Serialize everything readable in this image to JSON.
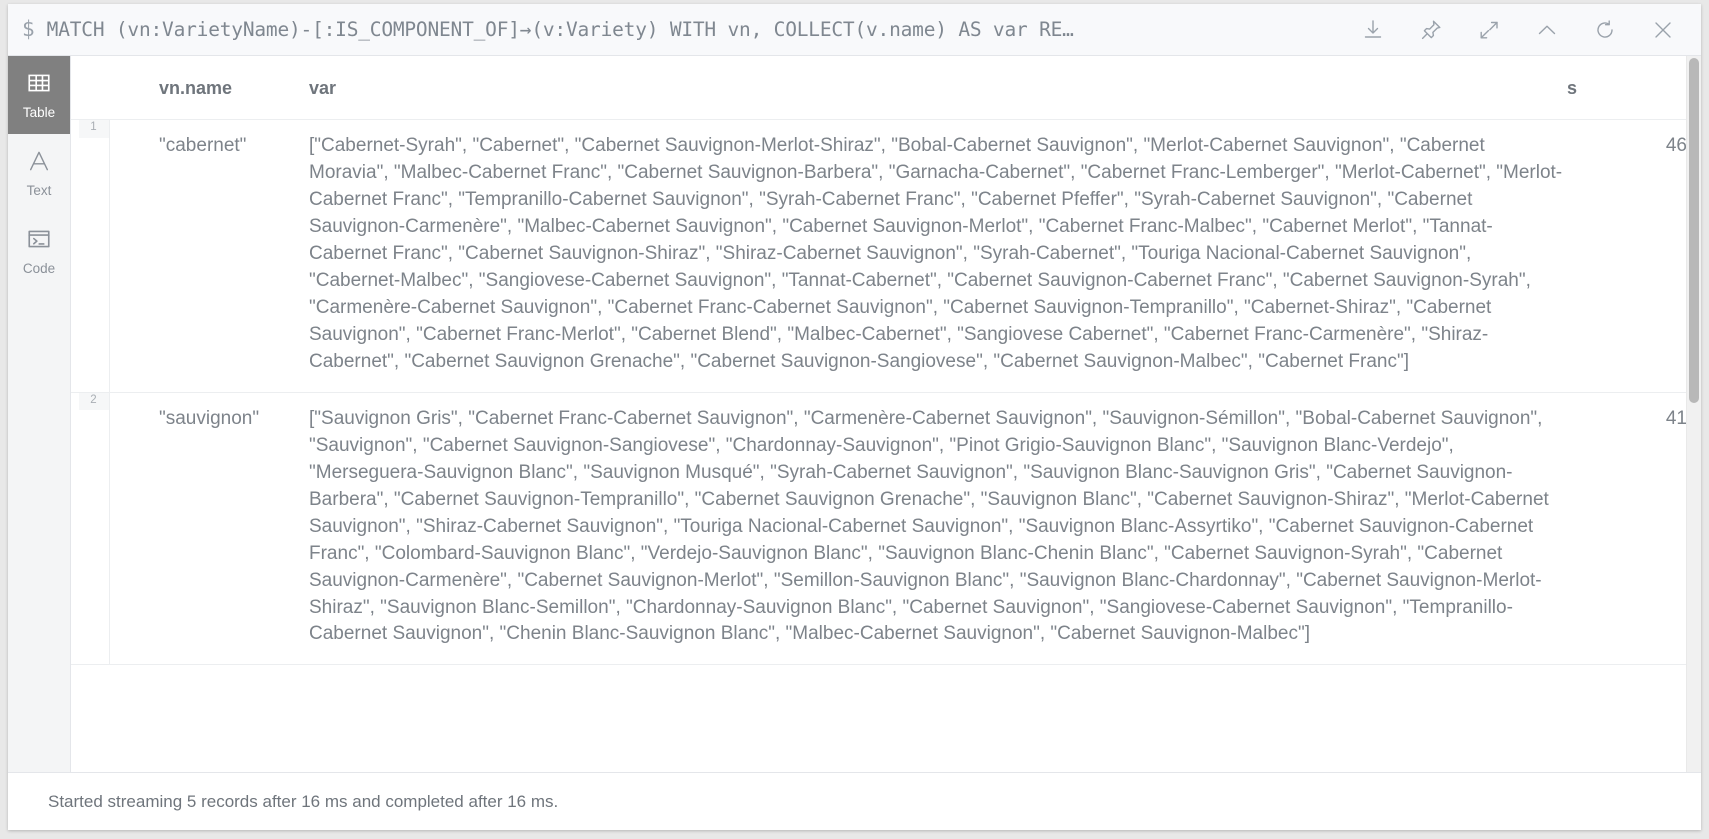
{
  "window": {
    "prompt_sigil": "$",
    "query": "MATCH (vn:VarietyName)-[:IS_COMPONENT_OF]→(v:Variety) WITH vn, COLLECT(v.name) AS var RE…",
    "actions": [
      {
        "name": "download-icon",
        "label": "Download"
      },
      {
        "name": "pin-icon",
        "label": "Pin"
      },
      {
        "name": "expand-icon",
        "label": "Fullscreen"
      },
      {
        "name": "chevron-up-icon",
        "label": "Collapse"
      },
      {
        "name": "refresh-icon",
        "label": "Rerun"
      },
      {
        "name": "close-icon",
        "label": "Close"
      }
    ]
  },
  "sidebar": {
    "items": [
      {
        "label": "Table",
        "icon": "table-icon",
        "active": true
      },
      {
        "label": "Text",
        "icon": "text-icon",
        "active": false
      },
      {
        "label": "Code",
        "icon": "code-icon",
        "active": false
      }
    ]
  },
  "table": {
    "columns": [
      "vn.name",
      "var",
      "s"
    ],
    "rows": [
      {
        "index": "1",
        "name": "\"cabernet\"",
        "var": "[\"Cabernet-Syrah\", \"Cabernet\", \"Cabernet Sauvignon-Merlot-Shiraz\", \"Bobal-Cabernet Sauvignon\", \"Merlot-Cabernet Sauvignon\", \"Cabernet Moravia\", \"Malbec-Cabernet Franc\", \"Cabernet Sauvignon-Barbera\", \"Garnacha-Cabernet\", \"Cabernet Franc-Lemberger\", \"Merlot-Cabernet\", \"Merlot-Cabernet Franc\", \"Tempranillo-Cabernet Sauvignon\", \"Syrah-Cabernet Franc\", \"Cabernet Pfeffer\", \"Syrah-Cabernet Sauvignon\", \"Cabernet Sauvignon-Carmenère\", \"Malbec-Cabernet Sauvignon\", \"Cabernet Sauvignon-Merlot\", \"Cabernet Franc-Malbec\", \"Cabernet Merlot\", \"Tannat-Cabernet Franc\", \"Cabernet Sauvignon-Shiraz\", \"Shiraz-Cabernet Sauvignon\", \"Syrah-Cabernet\", \"Touriga Nacional-Cabernet Sauvignon\", \"Cabernet-Malbec\", \"Sangiovese-Cabernet Sauvignon\", \"Tannat-Cabernet\", \"Cabernet Sauvignon-Cabernet Franc\", \"Cabernet Sauvignon-Syrah\", \"Carmenère-Cabernet Sauvignon\", \"Cabernet Franc-Cabernet Sauvignon\", \"Cabernet Sauvignon-Tempranillo\", \"Cabernet-Shiraz\", \"Cabernet Sauvignon\", \"Cabernet Franc-Merlot\", \"Cabernet Blend\", \"Malbec-Cabernet\", \"Sangiovese Cabernet\", \"Cabernet Franc-Carmenère\", \"Shiraz-Cabernet\", \"Cabernet Sauvignon Grenache\", \"Cabernet Sauvignon-Sangiovese\", \"Cabernet Sauvignon-Malbec\", \"Cabernet Franc\"]",
        "s": "46"
      },
      {
        "index": "2",
        "name": "\"sauvignon\"",
        "var": "[\"Sauvignon Gris\", \"Cabernet Franc-Cabernet Sauvignon\", \"Carmenère-Cabernet Sauvignon\", \"Sauvignon-Sémillon\", \"Bobal-Cabernet Sauvignon\", \"Sauvignon\", \"Cabernet Sauvignon-Sangiovese\", \"Chardonnay-Sauvignon\", \"Pinot Grigio-Sauvignon Blanc\", \"Sauvignon Blanc-Verdejo\", \"Merseguera-Sauvignon Blanc\", \"Sauvignon Musqué\", \"Syrah-Cabernet Sauvignon\", \"Sauvignon Blanc-Sauvignon Gris\", \"Cabernet Sauvignon-Barbera\", \"Cabernet Sauvignon-Tempranillo\", \"Cabernet Sauvignon Grenache\", \"Sauvignon Blanc\", \"Cabernet Sauvignon-Shiraz\", \"Merlot-Cabernet Sauvignon\", \"Shiraz-Cabernet Sauvignon\", \"Touriga Nacional-Cabernet Sauvignon\", \"Sauvignon Blanc-Assyrtiko\", \"Cabernet Sauvignon-Cabernet Franc\", \"Colombard-Sauvignon Blanc\", \"Verdejo-Sauvignon Blanc\", \"Sauvignon Blanc-Chenin Blanc\", \"Cabernet Sauvignon-Syrah\", \"Cabernet Sauvignon-Carmenère\", \"Cabernet Sauvignon-Merlot\", \"Semillon-Sauvignon Blanc\", \"Sauvignon Blanc-Chardonnay\", \"Cabernet Sauvignon-Merlot-Shiraz\", \"Sauvignon Blanc-Semillon\", \"Chardonnay-Sauvignon Blanc\", \"Cabernet Sauvignon\", \"Sangiovese-Cabernet Sauvignon\", \"Tempranillo-Cabernet Sauvignon\", \"Chenin Blanc-Sauvignon Blanc\", \"Malbec-Cabernet Sauvignon\", \"Cabernet Sauvignon-Malbec\"]",
        "s": "41"
      }
    ]
  },
  "status": {
    "message": "Started streaming 5 records after 16 ms and completed after 16 ms."
  }
}
